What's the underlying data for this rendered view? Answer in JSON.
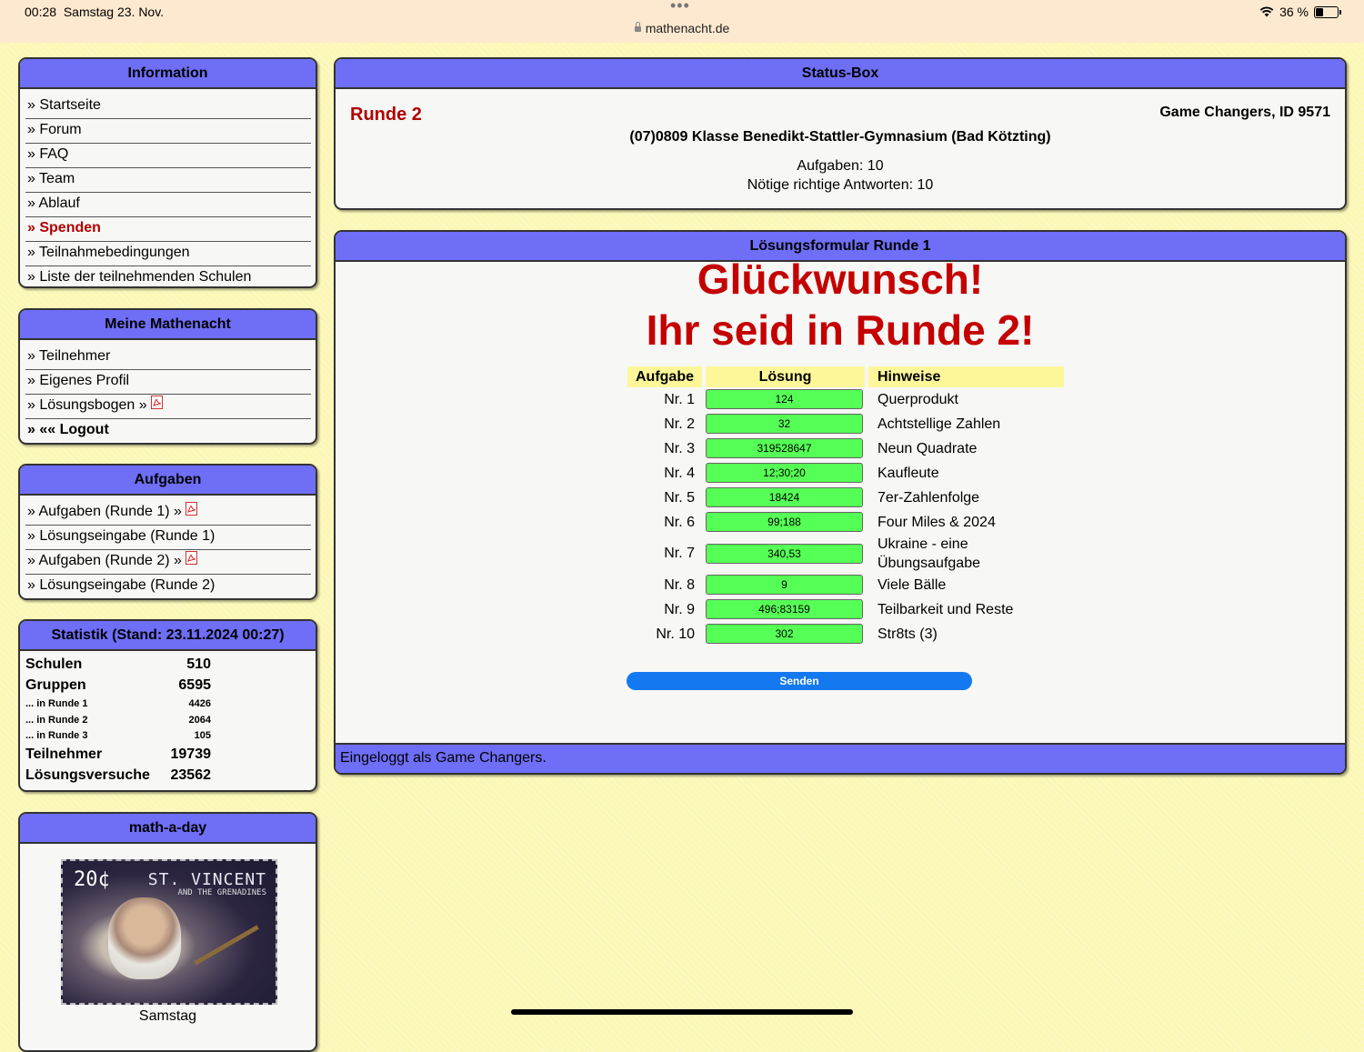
{
  "statusbar": {
    "time": "00:28",
    "date": "Samstag 23. Nov.",
    "url": "mathenacht.de",
    "battery": "36 %",
    "battery_level": 0.36
  },
  "sidebar": {
    "information": {
      "title": "Information",
      "items": [
        "» Startseite",
        "» Forum",
        "» FAQ",
        "» Team",
        "» Ablauf",
        "» Spenden",
        "» Teilnahmebedingungen",
        "» Liste der teilnehmenden Schulen"
      ]
    },
    "meine": {
      "title": "Meine Mathenacht",
      "items": [
        "» Teilnehmer",
        "» Eigenes Profil",
        "» Lösungsbogen »",
        "» «« Logout"
      ]
    },
    "aufgaben": {
      "title": "Aufgaben",
      "items": [
        "» Aufgaben (Runde 1) »",
        "» Lösungseingabe (Runde 1)",
        "» Aufgaben (Runde 2) »",
        "» Lösungseingabe (Runde 2)"
      ]
    },
    "statistik": {
      "title": "Statistik (Stand: 23.11.2024 00:27)",
      "rows": [
        {
          "label": "Schulen",
          "value": "510"
        },
        {
          "label": "Gruppen",
          "value": "6595"
        },
        {
          "label": "... in Runde 1",
          "value": "4426"
        },
        {
          "label": "... in Runde 2",
          "value": "2064"
        },
        {
          "label": "... in Runde 3",
          "value": "105"
        },
        {
          "label": "Teilnehmer",
          "value": "19739"
        },
        {
          "label": "Lösungsversuche",
          "value": "23562"
        }
      ]
    },
    "mathaday": {
      "title": "math-a-day",
      "stamp_value": "20¢",
      "stamp_country": "ST. VINCENT",
      "stamp_sub": "AND THE GRENADINES",
      "day": "Samstag"
    }
  },
  "status": {
    "title": "Status-Box",
    "runde": "Runde 2",
    "team": "Game Changers, ID 9571",
    "school": "(07)0809 Klasse Benedikt-Stattler-Gymnasium (Bad Kötzting)",
    "aufgaben": "Aufgaben: 10",
    "noetig": "Nötige richtige Antworten: 10"
  },
  "form": {
    "title": "Lösungsformular Runde 1",
    "congrats_line1": "Glückwunsch!",
    "congrats_line2": "Ihr seid in Runde 2!",
    "headers": {
      "aufgabe": "Aufgabe",
      "loesung": "Lösung",
      "hinweise": "Hinweise"
    },
    "rows": [
      {
        "nr": "Nr. 1",
        "answer": "124",
        "hint": "Querprodukt"
      },
      {
        "nr": "Nr. 2",
        "answer": "32",
        "hint": "Achtstellige Zahlen"
      },
      {
        "nr": "Nr. 3",
        "answer": "319528647",
        "hint": "Neun Quadrate"
      },
      {
        "nr": "Nr. 4",
        "answer": "12;30;20",
        "hint": "Kaufleute"
      },
      {
        "nr": "Nr. 5",
        "answer": "18424",
        "hint": "7er-Zahlenfolge"
      },
      {
        "nr": "Nr. 6",
        "answer": "99;188",
        "hint": "Four Miles & 2024"
      },
      {
        "nr": "Nr. 7",
        "answer": "340,53",
        "hint": "Ukraine - eine Übungsaufgabe"
      },
      {
        "nr": "Nr. 8",
        "answer": "9",
        "hint": "Viele Bälle"
      },
      {
        "nr": "Nr. 9",
        "answer": "496;83159",
        "hint": "Teilbarkeit und Reste"
      },
      {
        "nr": "Nr. 10",
        "answer": "302",
        "hint": "Str8ts (3)"
      }
    ],
    "send_label": "Senden",
    "footer": "Eingeloggt als Game Changers."
  },
  "colors": {
    "accent": "#6e6ef7",
    "brand_red": "#c40000",
    "answer_green": "#55ff55",
    "send_blue": "#1479f0",
    "header_yellow": "#fdf79a"
  }
}
